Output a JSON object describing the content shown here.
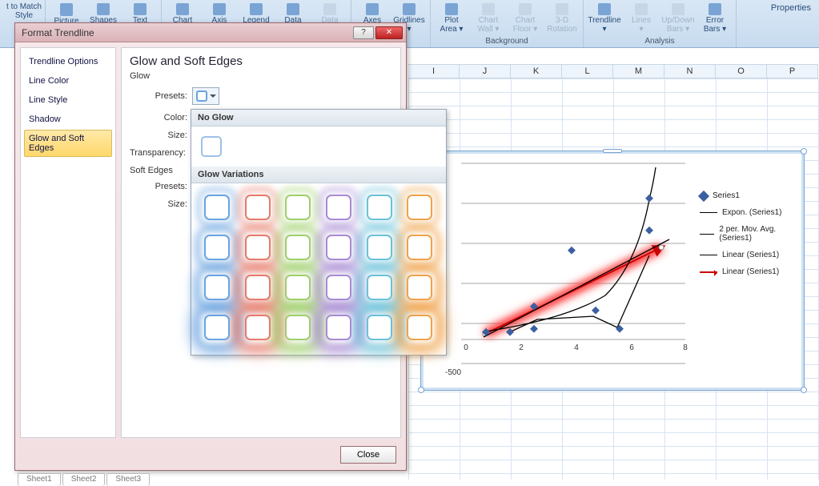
{
  "ribbon": {
    "btns": [
      {
        "l": "t to Match Style",
        "dim": false
      },
      {
        "l": "Picture",
        "dim": false
      },
      {
        "l": "Shapes\n▾",
        "dim": false
      },
      {
        "l": "Text\nBox",
        "dim": false
      },
      {
        "l": "Chart\nTitle ▾",
        "dim": false
      },
      {
        "l": "Axis\nTitles ▾",
        "dim": false
      },
      {
        "l": "Legend\n▾",
        "dim": false
      },
      {
        "l": "Data\nLabels ▾",
        "dim": false
      },
      {
        "l": "Data\nTable ▾",
        "dim": true
      },
      {
        "l": "Axes\n▾",
        "dim": false
      },
      {
        "l": "Gridlines\n▾",
        "dim": false
      },
      {
        "l": "Plot\nArea ▾",
        "dim": false
      },
      {
        "l": "Chart\nWall ▾",
        "dim": true
      },
      {
        "l": "Chart\nFloor ▾",
        "dim": true
      },
      {
        "l": "3-D\nRotation",
        "dim": true
      },
      {
        "l": "Trendline\n▾",
        "dim": false
      },
      {
        "l": "Lines\n▾",
        "dim": true
      },
      {
        "l": "Up/Down\nBars ▾",
        "dim": true
      },
      {
        "l": "Error\nBars ▾",
        "dim": false
      }
    ],
    "groups": [
      null,
      null,
      null,
      null,
      null,
      null,
      null,
      "Background",
      "Analysis"
    ],
    "props": "Properties"
  },
  "cols": [
    "I",
    "J",
    "K",
    "L",
    "M",
    "N",
    "O",
    "P"
  ],
  "sheets": [
    "Sheet1",
    "Sheet2",
    "Sheet3"
  ],
  "dialog": {
    "title": "Format Trendline",
    "cats": [
      "Trendline Options",
      "Line Color",
      "Line Style",
      "Shadow",
      "Glow and Soft Edges"
    ],
    "sel": 4,
    "heading": "Glow and Soft Edges",
    "sect_glow": "Glow",
    "lbl_presets": "Presets:",
    "lbl_color": "Color:",
    "lbl_size": "Size:",
    "lbl_transp": "Transparency:",
    "sect_soft": "Soft Edges",
    "lbl_presets2": "Presets:",
    "lbl_size2": "Size:",
    "close": "Close"
  },
  "glow": {
    "hdr_noglow": "No Glow",
    "hdr_var": "Glow Variations",
    "colors": [
      "#6aa3e0",
      "#e77a6a",
      "#9ecf6a",
      "#a88ad4",
      "#6ac1d9",
      "#f0a24a"
    ]
  },
  "legend": {
    "s1": "Series1",
    "expon": "Expon. (Series1)",
    "movavg": "2 per. Mov. Avg. (Series1)",
    "lin1": "Linear (Series1)",
    "lin2": "Linear (Series1)"
  },
  "axis_x": [
    "0",
    "2",
    "4",
    "6",
    "8"
  ],
  "axis_y": "-500",
  "chart_data": {
    "type": "scatter",
    "series": [
      {
        "name": "Series1",
        "kind": "points",
        "x": [
          1,
          2,
          3,
          3,
          5,
          5,
          6,
          7,
          7,
          7
        ],
        "y": [
          0,
          0,
          50,
          350,
          350,
          100,
          50,
          800,
          750,
          1600
        ]
      },
      {
        "name": "Expon. (Series1)",
        "kind": "line-curve",
        "x": [
          1,
          2,
          3,
          4,
          5,
          6,
          7,
          7.5
        ],
        "y": [
          20,
          40,
          80,
          160,
          350,
          750,
          1500,
          2100
        ]
      },
      {
        "name": "2 per. Mov. Avg. (Series1)",
        "kind": "line",
        "x": [
          2,
          3,
          4,
          5,
          6,
          7
        ],
        "y": [
          0,
          175,
          200,
          225,
          75,
          775
        ]
      },
      {
        "name": "Linear (Series1)",
        "kind": "line",
        "x": [
          1,
          7.5
        ],
        "y": [
          -100,
          1050
        ]
      },
      {
        "name": "Linear (Series1)",
        "kind": "arrow-glow",
        "x": [
          1,
          7.5
        ],
        "y": [
          -100,
          1050
        ]
      }
    ],
    "xlim": [
      0,
      8
    ],
    "ylim": [
      -500,
      2200
    ],
    "xticks": [
      0,
      2,
      4,
      6,
      8
    ]
  }
}
